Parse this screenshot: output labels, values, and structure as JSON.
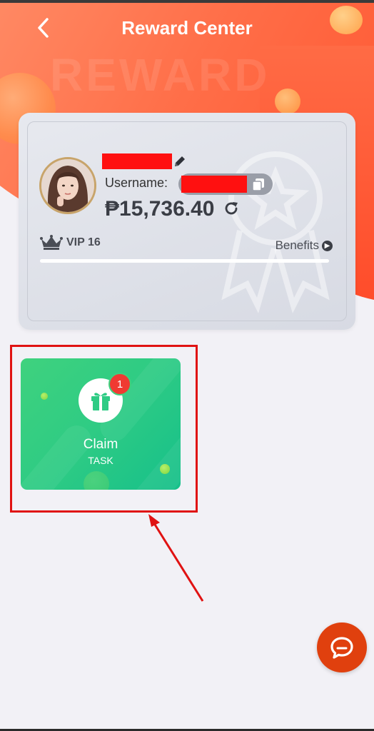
{
  "header": {
    "title": "Reward Center",
    "watermark": "REWARD"
  },
  "profile": {
    "username_label": "Username:",
    "balance": "₱15,736.40",
    "vip_level": "VIP 16",
    "benefits_label": "Benefits",
    "vip_progress": 0
  },
  "tasks": [
    {
      "title": "Claim",
      "subtitle": "TASK",
      "badge_count": "1"
    }
  ],
  "colors": {
    "accent_orange": "#ff5a32",
    "task_green": "#2ecb84",
    "badge_red": "#f03a32",
    "chat_button": "#e0400e",
    "annotation_red": "#e01212"
  },
  "icons": {
    "back": "chevron-left-icon",
    "edit": "pencil-icon",
    "copy": "copy-icon",
    "refresh": "refresh-icon",
    "vip": "crown-icon",
    "benefits_arrow": "chevron-right-circle-icon",
    "task": "gift-icon",
    "chat": "chat-bubble-icon"
  }
}
